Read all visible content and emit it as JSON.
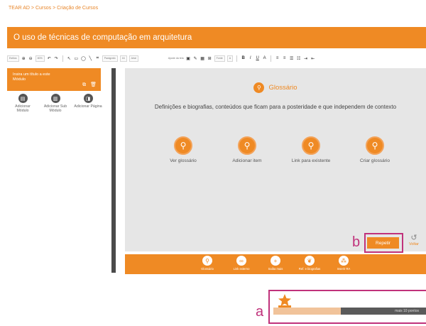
{
  "breadcrumb": {
    "items": [
      "TEAR AD",
      "Cursos",
      "Criação de Cursos"
    ],
    "separator": " > "
  },
  "course": {
    "title": "O uso de técnicas de computação em arquitetura"
  },
  "toolbar": {
    "styles": "Estilos",
    "zoom": "80%",
    "paragraph_format": "Parágrafo",
    "size": "16",
    "font": "Arial",
    "rotate_label": "Ajuste da tela",
    "size2": "Fonte",
    "color_value": "A"
  },
  "module": {
    "text": "Insira um título a este Módulo",
    "add_items": [
      {
        "label": "Adicionar Módulo",
        "icon": "module-icon"
      },
      {
        "label": "Adicionar Sub Módulo",
        "icon": "submodule-icon"
      },
      {
        "label": "Adicionar Página",
        "icon": "page-icon"
      }
    ]
  },
  "glossary": {
    "title": "Glossário",
    "description": "Definições e biografias, conteúdos que ficam para a posteridade e que independem de contexto",
    "actions": [
      {
        "label": "Ver glossário",
        "icon": "view-glossary-icon"
      },
      {
        "label": "Adicionar item",
        "icon": "add-item-icon"
      },
      {
        "label": "Link para existente",
        "icon": "link-icon"
      },
      {
        "label": "Criar glossário",
        "icon": "create-glossary-icon"
      }
    ]
  },
  "repeat_button": "Repetir",
  "back_button": "Voltar",
  "annotation_labels": {
    "a": "a",
    "b": "b"
  },
  "bottom_bar": [
    {
      "label": "Glossário",
      "icon": "glossary-icon"
    },
    {
      "label": "Link externo",
      "icon": "external-link-icon"
    },
    {
      "label": "Saiba mais",
      "icon": "plus-icon"
    },
    {
      "label": "Ref. e biografias",
      "icon": "references-icon"
    },
    {
      "label": "Inserir RA",
      "icon": "ar-icon"
    }
  ],
  "progress": {
    "text": "mais 10 pontos",
    "fill_fraction": 0.44,
    "icon": "trophy-icon"
  },
  "colors": {
    "accent": "#ef8a24",
    "annotation": "#c0327b",
    "panel": "#e6e6e6"
  }
}
